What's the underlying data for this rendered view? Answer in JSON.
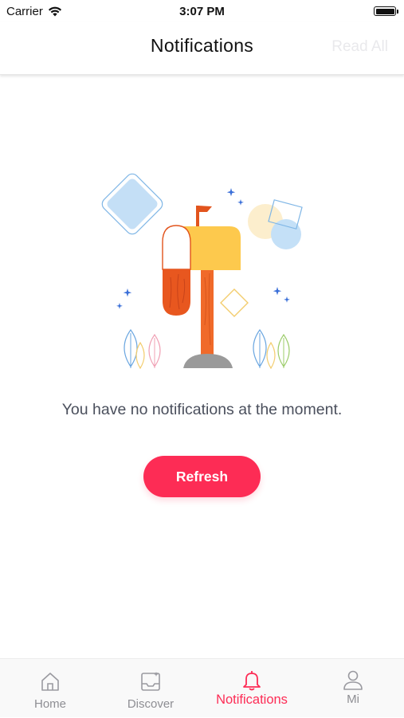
{
  "status_bar": {
    "carrier": "Carrier",
    "time": "3:07 PM",
    "icons": [
      "wifi-icon",
      "battery-icon"
    ]
  },
  "header": {
    "title": "Notifications",
    "action_label": "Read All"
  },
  "empty_state": {
    "illustration": "mailbox-illustration",
    "message": "You have no notifications at the moment.",
    "button_label": "Refresh"
  },
  "tab_bar": {
    "active_index": 2,
    "items": [
      {
        "label": "Home",
        "icon": "home-icon"
      },
      {
        "label": "Discover",
        "icon": "discover-icon"
      },
      {
        "label": "Notifications",
        "icon": "bell-icon"
      },
      {
        "label": "Mi",
        "icon": "user-icon"
      }
    ]
  },
  "colors": {
    "accent": "#fd2c55",
    "inactive_tab": "#8e8e93",
    "disabled_action": "#e9e9ec",
    "message_text": "#4a4f5c"
  }
}
